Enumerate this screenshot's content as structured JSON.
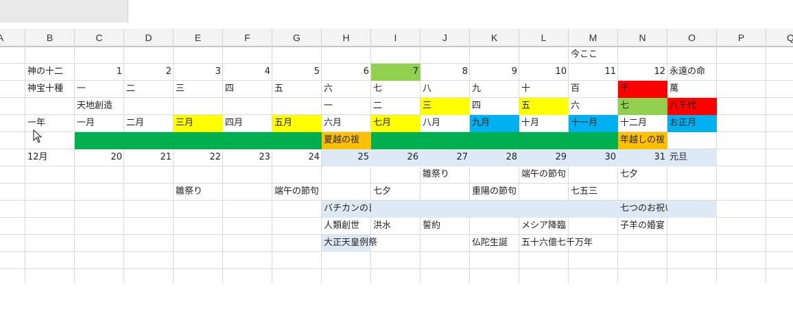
{
  "columns": [
    "A",
    "B",
    "C",
    "D",
    "E",
    "F",
    "G",
    "H",
    "I",
    "J",
    "K",
    "L",
    "M",
    "N",
    "O",
    "P",
    "Q"
  ],
  "rows": [
    {
      "r": 1,
      "cells": [
        {
          "c": "M",
          "v": "今ここ"
        }
      ]
    },
    {
      "r": 2,
      "cells": [
        {
          "c": "B",
          "v": "神の十二"
        },
        {
          "c": "C",
          "v": "1",
          "num": true
        },
        {
          "c": "D",
          "v": "2",
          "num": true
        },
        {
          "c": "E",
          "v": "3",
          "num": true
        },
        {
          "c": "F",
          "v": "4",
          "num": true
        },
        {
          "c": "G",
          "v": "5",
          "num": true
        },
        {
          "c": "H",
          "v": "6",
          "num": true
        },
        {
          "c": "I",
          "v": "7",
          "num": true,
          "bg": "#92d050"
        },
        {
          "c": "J",
          "v": "8",
          "num": true
        },
        {
          "c": "K",
          "v": "9",
          "num": true
        },
        {
          "c": "L",
          "v": "10",
          "num": true
        },
        {
          "c": "M",
          "v": "11",
          "num": true
        },
        {
          "c": "N",
          "v": "12",
          "num": true
        },
        {
          "c": "O",
          "v": "永遠の命"
        }
      ]
    },
    {
      "r": 3,
      "cells": [
        {
          "c": "B",
          "v": "神宝十種"
        },
        {
          "c": "C",
          "v": "一"
        },
        {
          "c": "D",
          "v": "二"
        },
        {
          "c": "E",
          "v": "三"
        },
        {
          "c": "F",
          "v": "四"
        },
        {
          "c": "G",
          "v": "五"
        },
        {
          "c": "H",
          "v": "六"
        },
        {
          "c": "I",
          "v": "七"
        },
        {
          "c": "J",
          "v": "八"
        },
        {
          "c": "K",
          "v": "九"
        },
        {
          "c": "L",
          "v": "十"
        },
        {
          "c": "M",
          "v": "百"
        },
        {
          "c": "N",
          "v": "千",
          "bg": "#ff0000"
        },
        {
          "c": "O",
          "v": "萬"
        }
      ]
    },
    {
      "r": 4,
      "cells": [
        {
          "c": "C",
          "v": "天地創造"
        },
        {
          "c": "H",
          "v": "一"
        },
        {
          "c": "I",
          "v": "二"
        },
        {
          "c": "J",
          "v": "三",
          "bg": "#ffff00"
        },
        {
          "c": "K",
          "v": "四"
        },
        {
          "c": "L",
          "v": "五",
          "bg": "#ffff00"
        },
        {
          "c": "M",
          "v": "六"
        },
        {
          "c": "N",
          "v": "七",
          "bg": "#92d050"
        },
        {
          "c": "O",
          "v": "八千代",
          "bg": "#ff0000"
        }
      ]
    },
    {
      "r": 5,
      "cells": [
        {
          "c": "B",
          "v": "一年"
        },
        {
          "c": "C",
          "v": "一月"
        },
        {
          "c": "D",
          "v": "二月"
        },
        {
          "c": "E",
          "v": "三月",
          "bg": "#ffff00"
        },
        {
          "c": "F",
          "v": "四月"
        },
        {
          "c": "G",
          "v": "五月",
          "bg": "#ffff00"
        },
        {
          "c": "H",
          "v": "六月"
        },
        {
          "c": "I",
          "v": "七月",
          "bg": "#ffff00"
        },
        {
          "c": "J",
          "v": "八月"
        },
        {
          "c": "K",
          "v": "九月",
          "bg": "#00b0f0"
        },
        {
          "c": "L",
          "v": "十月"
        },
        {
          "c": "M",
          "v": "十一月",
          "bg": "#00b0f0"
        },
        {
          "c": "N",
          "v": "十二月"
        },
        {
          "c": "O",
          "v": "お正月",
          "bg": "#00b0f0"
        }
      ]
    },
    {
      "r": 6,
      "cells": [
        {
          "c": "C",
          "v": "",
          "bg": "#00b050"
        },
        {
          "c": "D",
          "v": "",
          "bg": "#00b050"
        },
        {
          "c": "E",
          "v": "",
          "bg": "#00b050"
        },
        {
          "c": "F",
          "v": "",
          "bg": "#00b050"
        },
        {
          "c": "G",
          "v": "",
          "bg": "#00b050"
        },
        {
          "c": "H",
          "v": "夏越の祓",
          "bg": "#ffc000"
        },
        {
          "c": "I",
          "v": "",
          "bg": "#00b050"
        },
        {
          "c": "J",
          "v": "",
          "bg": "#00b050"
        },
        {
          "c": "K",
          "v": "",
          "bg": "#00b050"
        },
        {
          "c": "L",
          "v": "",
          "bg": "#00b050"
        },
        {
          "c": "M",
          "v": "",
          "bg": "#00b050"
        },
        {
          "c": "N",
          "v": "年越しの祓",
          "bg": "#ffc000"
        }
      ]
    },
    {
      "r": 7,
      "cells": [
        {
          "c": "B",
          "v": "12月"
        },
        {
          "c": "C",
          "v": "20",
          "num": true
        },
        {
          "c": "D",
          "v": "21",
          "num": true
        },
        {
          "c": "E",
          "v": "22",
          "num": true
        },
        {
          "c": "F",
          "v": "23",
          "num": true
        },
        {
          "c": "G",
          "v": "24",
          "num": true
        },
        {
          "c": "H",
          "v": "25",
          "num": true,
          "bg": "#dde9f5"
        },
        {
          "c": "I",
          "v": "26",
          "num": true,
          "bg": "#dde9f5"
        },
        {
          "c": "J",
          "v": "27",
          "num": true,
          "bg": "#dde9f5"
        },
        {
          "c": "K",
          "v": "28",
          "num": true,
          "bg": "#dde9f5"
        },
        {
          "c": "L",
          "v": "29",
          "num": true,
          "bg": "#dde9f5"
        },
        {
          "c": "M",
          "v": "30",
          "num": true,
          "bg": "#dde9f5"
        },
        {
          "c": "N",
          "v": "31",
          "num": true,
          "bg": "#dde9f5"
        },
        {
          "c": "O",
          "v": "元旦",
          "bg": "#dde9f5"
        }
      ]
    },
    {
      "r": 8,
      "cells": [
        {
          "c": "J",
          "v": "雛祭り"
        },
        {
          "c": "L",
          "v": "端午の節句"
        },
        {
          "c": "N",
          "v": "七夕"
        }
      ]
    },
    {
      "r": 9,
      "cells": [
        {
          "c": "E",
          "v": "雛祭り"
        },
        {
          "c": "G",
          "v": "端午の節句"
        },
        {
          "c": "I",
          "v": "七夕"
        },
        {
          "c": "K",
          "v": "重陽の節句"
        },
        {
          "c": "M",
          "v": "七五三"
        }
      ]
    },
    {
      "r": 10,
      "cells": [
        {
          "c": "H",
          "v": "バチカンの日",
          "bg": "#dde9f5"
        },
        {
          "c": "I",
          "v": "",
          "bg": "#dde9f5"
        },
        {
          "c": "J",
          "v": "",
          "bg": "#dde9f5"
        },
        {
          "c": "K",
          "v": "",
          "bg": "#dde9f5"
        },
        {
          "c": "L",
          "v": "",
          "bg": "#dde9f5"
        },
        {
          "c": "M",
          "v": "",
          "bg": "#dde9f5"
        },
        {
          "c": "N",
          "v": "七つのお祝い",
          "bg": "#dde9f5"
        },
        {
          "c": "O",
          "v": "",
          "bg": "#dde9f5"
        }
      ]
    },
    {
      "r": 11,
      "cells": [
        {
          "c": "H",
          "v": "人類創世"
        },
        {
          "c": "I",
          "v": "洪水"
        },
        {
          "c": "J",
          "v": "誓約"
        },
        {
          "c": "L",
          "v": "メシア降臨"
        },
        {
          "c": "N",
          "v": "子羊の婚宴"
        }
      ]
    },
    {
      "r": 12,
      "cells": [
        {
          "c": "H",
          "v": "大正天皇例祭",
          "bg": "#dde9f5"
        },
        {
          "c": "K",
          "v": "仏陀生誕"
        },
        {
          "c": "L",
          "v": "五十六億七千万年"
        }
      ]
    }
  ]
}
